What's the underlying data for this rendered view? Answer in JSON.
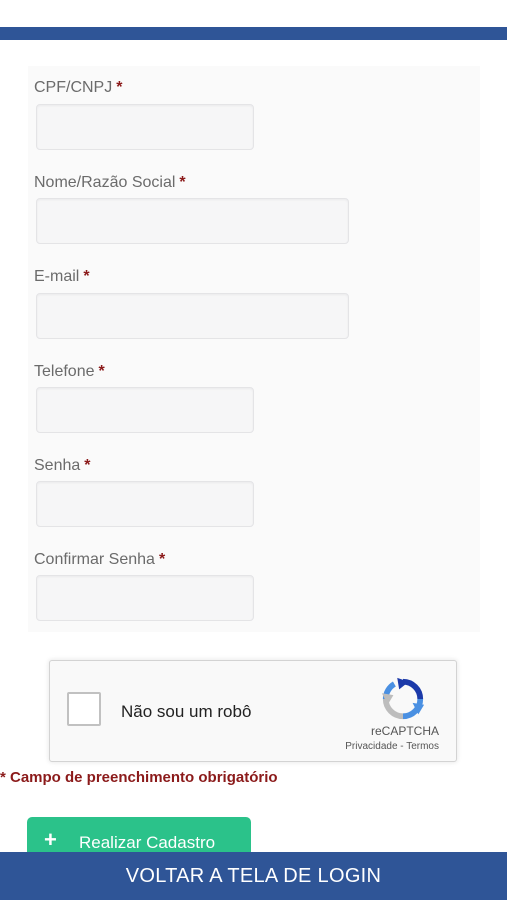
{
  "colors": {
    "primary": "#2f5597",
    "accent_green": "#2bc28a",
    "required_red": "#8b1a1a"
  },
  "form": {
    "required_marker": "*",
    "fields": [
      {
        "label": "CPF/CNPJ",
        "value": ""
      },
      {
        "label": "Nome/Razão Social",
        "value": ""
      },
      {
        "label": "E-mail",
        "value": ""
      },
      {
        "label": "Telefone",
        "value": ""
      },
      {
        "label": "Senha",
        "value": ""
      },
      {
        "label": "Confirmar Senha",
        "value": ""
      }
    ]
  },
  "recaptcha": {
    "checkbox_label": "Não sou um robô",
    "checked": false,
    "brand": "reCAPTCHA",
    "links": "Privacidade - Termos",
    "icon": "recaptcha-logo"
  },
  "required_note": "* Campo de preenchimento obrigatório",
  "register_button": {
    "icon": "plus-icon",
    "label": "Realizar Cadastro"
  },
  "footer": {
    "back_to_login_label": "VOLTAR A TELA DE LOGIN"
  }
}
